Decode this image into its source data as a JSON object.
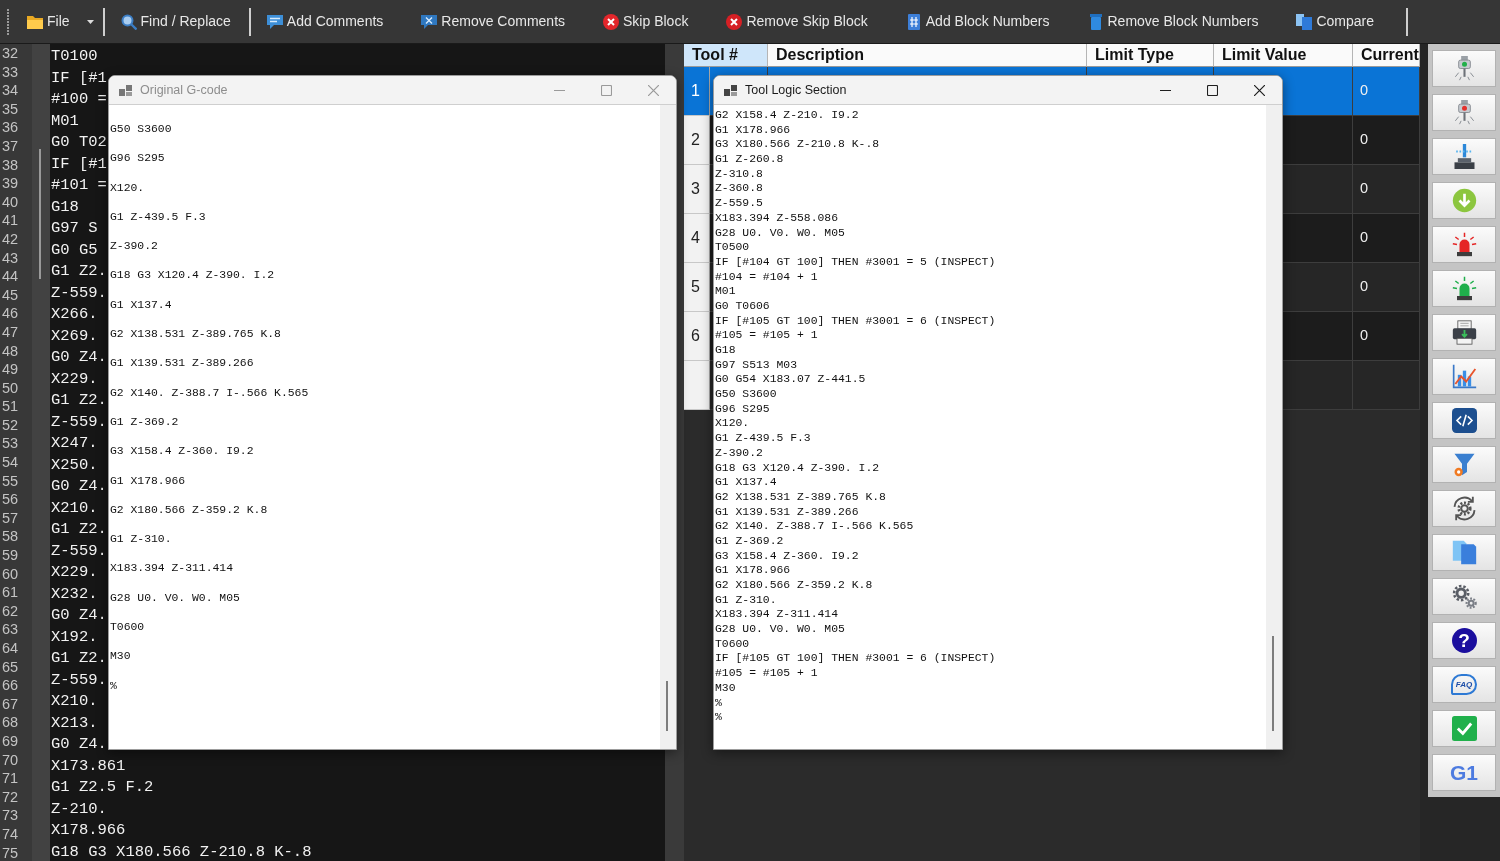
{
  "toolbar": {
    "groups": [
      [
        {
          "kind": "folder",
          "label": "File",
          "menu": true
        }
      ],
      [
        {
          "kind": "search",
          "label": "Find / Replace",
          "menu": false
        }
      ],
      [
        {
          "kind": "comment",
          "label": "Add Comments",
          "menu": false
        },
        {
          "kind": "uncomment",
          "label": "Remove Comments",
          "menu": false
        },
        {
          "kind": "skip",
          "label": "Skip Block",
          "menu": false
        },
        {
          "kind": "unskip",
          "label": "Remove Skip Block",
          "menu": false
        },
        {
          "kind": "number",
          "label": "Add Block Numbers",
          "menu": false
        },
        {
          "kind": "unnumber",
          "label": "Remove Block Numbers",
          "menu": false
        },
        {
          "kind": "compare",
          "label": "Compare",
          "menu": false
        }
      ]
    ]
  },
  "editor": {
    "line_numbers": [
      "32",
      "33",
      "34",
      "35",
      "36",
      "37",
      "38",
      "39",
      "40",
      "41",
      "42",
      "43",
      "44",
      "45",
      "46",
      "47",
      "48",
      "49",
      "50",
      "51",
      "52",
      "53",
      "54",
      "55",
      "56",
      "57",
      "58",
      "59",
      "60",
      "61",
      "62",
      "63",
      "64",
      "65",
      "66",
      "67",
      "68",
      "69",
      "70",
      "71",
      "72",
      "73",
      "74",
      "75"
    ],
    "lines": [
      "T0100",
      "IF [#1",
      "#100 =",
      "M01",
      "G0 T02",
      "IF [#1",
      "#101 =",
      "G18",
      "G97 S",
      "G0 G5",
      "G1 Z2.",
      "Z-559.",
      "X266.",
      "X269.",
      "G0 Z4.",
      "X229.",
      "G1 Z2.",
      "Z-559.",
      "X247.",
      "X250.",
      "G0 Z4.",
      "X210.",
      "G1 Z2.",
      "Z-559.",
      "X229.",
      "X232.",
      "G0 Z4.",
      "X192.",
      "G1 Z2.",
      "Z-559.",
      "X210.",
      "X213.",
      "G0 Z4.",
      "X173.861",
      "G1 Z2.5 F.2",
      "Z-210.",
      "X178.966",
      "G18 G3 X180.566 Z-210.8 K-.8"
    ]
  },
  "table": {
    "columns": [
      {
        "label": "Tool #",
        "selected": true
      },
      {
        "label": "Description",
        "selected": false
      },
      {
        "label": "Limit Type",
        "selected": false
      },
      {
        "label": "Limit Value",
        "selected": false
      },
      {
        "label": "Current",
        "selected": false
      }
    ],
    "rows": [
      {
        "tool": "1",
        "current": "0",
        "selected": true
      },
      {
        "tool": "2",
        "current": "0",
        "selected": false
      },
      {
        "tool": "3",
        "current": "0",
        "selected": false
      },
      {
        "tool": "4",
        "current": "0",
        "selected": false
      },
      {
        "tool": "5",
        "current": "0",
        "selected": false
      },
      {
        "tool": "6",
        "current": "0",
        "selected": false
      }
    ]
  },
  "sidebar": {
    "buttons": [
      {
        "kind": "spindle"
      },
      {
        "kind": "spindlefault"
      },
      {
        "kind": "machine"
      },
      {
        "kind": "download"
      },
      {
        "kind": "alarm"
      },
      {
        "kind": "beacon"
      },
      {
        "kind": "printer"
      },
      {
        "kind": "chart"
      },
      {
        "kind": "code"
      },
      {
        "kind": "filter"
      },
      {
        "kind": "cycle"
      },
      {
        "kind": "documents"
      },
      {
        "kind": "settings"
      },
      {
        "kind": "help",
        "label": "?"
      },
      {
        "kind": "faq",
        "label": "FAQ"
      },
      {
        "kind": "check"
      },
      {
        "kind": "text",
        "label": "G1"
      }
    ]
  },
  "windows": [
    {
      "title": "Original G-code",
      "active": false,
      "double_spaced": true,
      "lines": [
        "G50 S3600",
        "G96 S295",
        "X120.",
        "G1 Z-439.5 F.3",
        "Z-390.2",
        "G18 G3 X120.4 Z-390. I.2",
        "G1 X137.4",
        "G2 X138.531 Z-389.765 K.8",
        "G1 X139.531 Z-389.266",
        "G2 X140. Z-388.7 I-.566 K.565",
        "G1 Z-369.2",
        "G3 X158.4 Z-360. I9.2",
        "G1 X178.966",
        "G2 X180.566 Z-359.2 K.8",
        "G1 Z-310.",
        "X183.394 Z-311.414",
        "G28 U0. V0. W0. M05",
        "T0600",
        "M30",
        "%"
      ]
    },
    {
      "title": "Tool Logic Section",
      "active": true,
      "double_spaced": false,
      "lines": [
        "G2 X158.4 Z-210. I9.2",
        "G1 X178.966",
        "G3 X180.566 Z-210.8 K-.8",
        "G1 Z-260.8",
        "Z-310.8",
        "Z-360.8",
        "Z-559.5",
        "X183.394 Z-558.086",
        "G28 U0. V0. W0. M05",
        "T0500",
        "IF [#104 GT 100] THEN #3001 = 5 (INSPECT)",
        "#104 = #104 + 1",
        "M01",
        "G0 T0606",
        "IF [#105 GT 100] THEN #3001 = 6 (INSPECT)",
        "#105 = #105 + 1",
        "G18",
        "G97 S513 M03",
        "G0 G54 X183.07 Z-441.5",
        "G50 S3600",
        "G96 S295",
        "X120.",
        "G1 Z-439.5 F.3",
        "Z-390.2",
        "G18 G3 X120.4 Z-390. I.2",
        "G1 X137.4",
        "G2 X138.531 Z-389.765 K.8",
        "G1 X139.531 Z-389.266",
        "G2 X140. Z-388.7 I-.566 K.565",
        "G1 Z-369.2",
        "G3 X158.4 Z-360. I9.2",
        "G1 X178.966",
        "G2 X180.566 Z-359.2 K.8",
        "G1 Z-310.",
        "X183.394 Z-311.414",
        "G28 U0. V0. W0. M05",
        "T0600",
        "IF [#105 GT 100] THEN #3001 = 6 (INSPECT)",
        "#105 = #105 + 1",
        "M30",
        "%",
        "%"
      ]
    }
  ]
}
